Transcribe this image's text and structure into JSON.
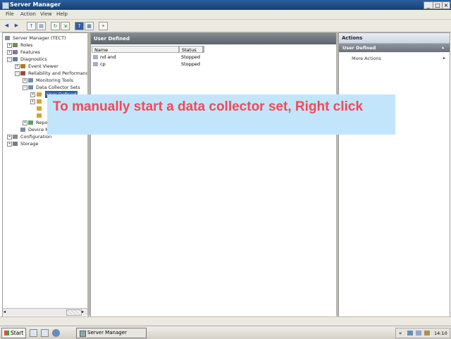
{
  "window": {
    "title": "Server Manager",
    "controls": {
      "minimize": "_",
      "maximize": "□",
      "close": "×"
    }
  },
  "menubar": {
    "items": [
      "File",
      "Action",
      "View",
      "Help"
    ]
  },
  "toolbar": {
    "icons": [
      "back-icon",
      "forward-icon",
      "up-icon",
      "show-hide-tree-icon",
      "refresh-icon",
      "export-icon",
      "help-icon",
      "properties-icon",
      "new-icon"
    ]
  },
  "tree": {
    "root": "Server Manager (TECT)",
    "roles": "Roles",
    "features": "Features",
    "diagnostics": "Diagnostics",
    "event_viewer": "Event Viewer",
    "reliability": "Reliability and Performance",
    "monitoring_tools": "Monitoring Tools",
    "data_collector_sets": "Data Collector Sets",
    "user_defined": "User Defined",
    "reports": "Repo",
    "device_manager": "Device M",
    "configuration": "Configuration",
    "storage": "Storage"
  },
  "center": {
    "header": "User Defined",
    "columns": [
      "Name",
      "Status"
    ],
    "rows": [
      {
        "name": "nd and",
        "status": "Stopped"
      },
      {
        "name": "cp",
        "status": "Stopped"
      }
    ]
  },
  "actions": {
    "header": "Actions",
    "section": "User Defined",
    "items": [
      "More Actions"
    ]
  },
  "taskbar": {
    "start": "Start",
    "task": "Server Manager",
    "clock": "14:10"
  },
  "callout": {
    "text": "To manually start a data collector set, Right click"
  }
}
